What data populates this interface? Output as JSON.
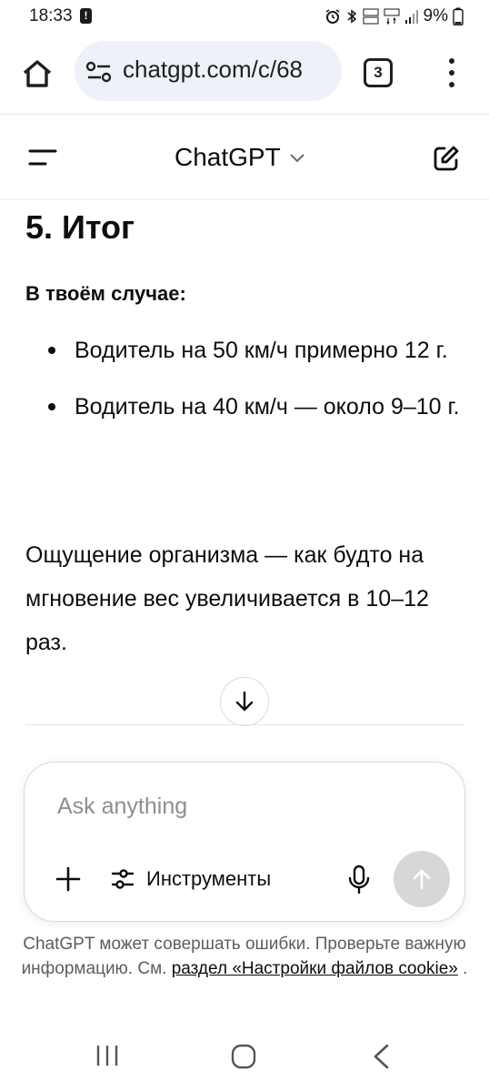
{
  "status_bar": {
    "time": "18:33",
    "alert_glyph": "!",
    "battery": "9%",
    "icons": [
      "alarm-icon",
      "bluetooth-icon",
      "volte-icon",
      "lte-icon",
      "signal-icon",
      "battery-icon"
    ]
  },
  "browser": {
    "url": "chatgpt.com/c/68",
    "tab_count": "3",
    "icons": [
      "home-icon",
      "site-settings-icon",
      "tabs-icon",
      "more-vert-icon"
    ]
  },
  "chat_header": {
    "title": "ChatGPT",
    "icons": [
      "menu-icon",
      "chevron-down-icon",
      "new-chat-icon"
    ]
  },
  "message": {
    "heading": "5. Итог",
    "case_label": "В твоём случае:",
    "bullets": [
      "Водитель на 50 км/ч примерно 12 г.",
      "Водитель на 40 км/ч — около 9–10 г."
    ],
    "paragraph": "Ощущение организма — как будто на мгновение вес увеличивается в 10–12 раз."
  },
  "composer": {
    "placeholder": "Ask anything",
    "value": "",
    "tools_label": "Инструменты",
    "icons": [
      "plus-icon",
      "sliders-icon",
      "mic-icon",
      "arrow-up-icon"
    ]
  },
  "disclaimer": {
    "text": "ChatGPT может совершать ошибки. Проверьте важную информацию. См.",
    "link": "раздел «Настройки файлов cookie»",
    "suffix": "."
  },
  "colors": {
    "url_pill": "#eef1f8",
    "send_disabled": "#d7d7d7",
    "text": "#0d0d0d",
    "muted": "#5d5d5d"
  }
}
